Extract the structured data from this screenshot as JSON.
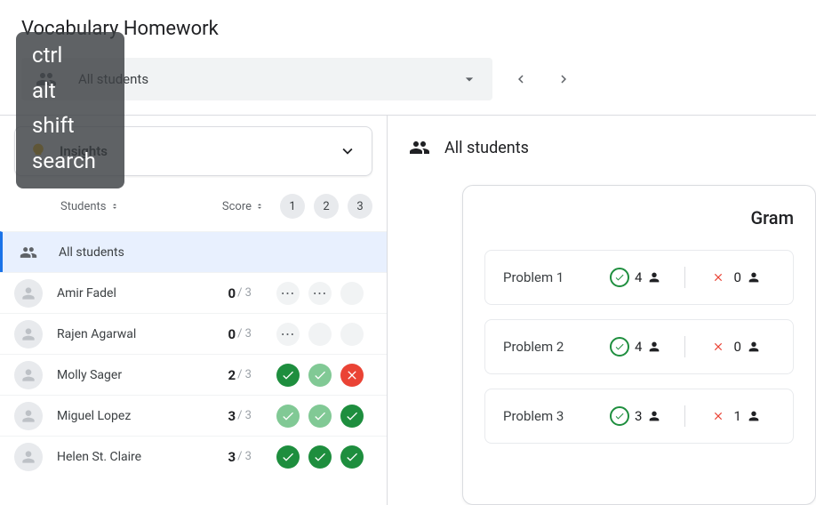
{
  "header": {
    "title": "Vocabulary Homework",
    "selector_label": "All students"
  },
  "insights": {
    "label": "Insights"
  },
  "table": {
    "students_header": "Students",
    "score_header": "Score",
    "problem_numbers": [
      "1",
      "2",
      "3"
    ]
  },
  "students": [
    {
      "name": "All students",
      "is_all": true
    },
    {
      "name": "Amir Fadel",
      "score": "0",
      "total": "3",
      "status": [
        "dots",
        "dots",
        "empty"
      ]
    },
    {
      "name": "Rajen Agarwal",
      "score": "0",
      "total": "3",
      "status": [
        "dots",
        "empty",
        "empty"
      ]
    },
    {
      "name": "Molly Sager",
      "score": "2",
      "total": "3",
      "status": [
        "solid-green",
        "light-green",
        "red"
      ]
    },
    {
      "name": "Miguel Lopez",
      "score": "3",
      "total": "3",
      "status": [
        "light-green",
        "light-green",
        "solid-green"
      ]
    },
    {
      "name": "Helen St. Claire",
      "score": "3",
      "total": "3",
      "status": [
        "solid-green",
        "solid-green",
        "solid-green"
      ]
    }
  ],
  "right": {
    "header": "All students",
    "card_title": "Gram",
    "problems": [
      {
        "name": "Problem 1",
        "correct": "4",
        "wrong": "0"
      },
      {
        "name": "Problem 2",
        "correct": "4",
        "wrong": "0"
      },
      {
        "name": "Problem 3",
        "correct": "3",
        "wrong": "1"
      }
    ]
  },
  "overlay": [
    "ctrl",
    "alt",
    "shift",
    "search"
  ]
}
